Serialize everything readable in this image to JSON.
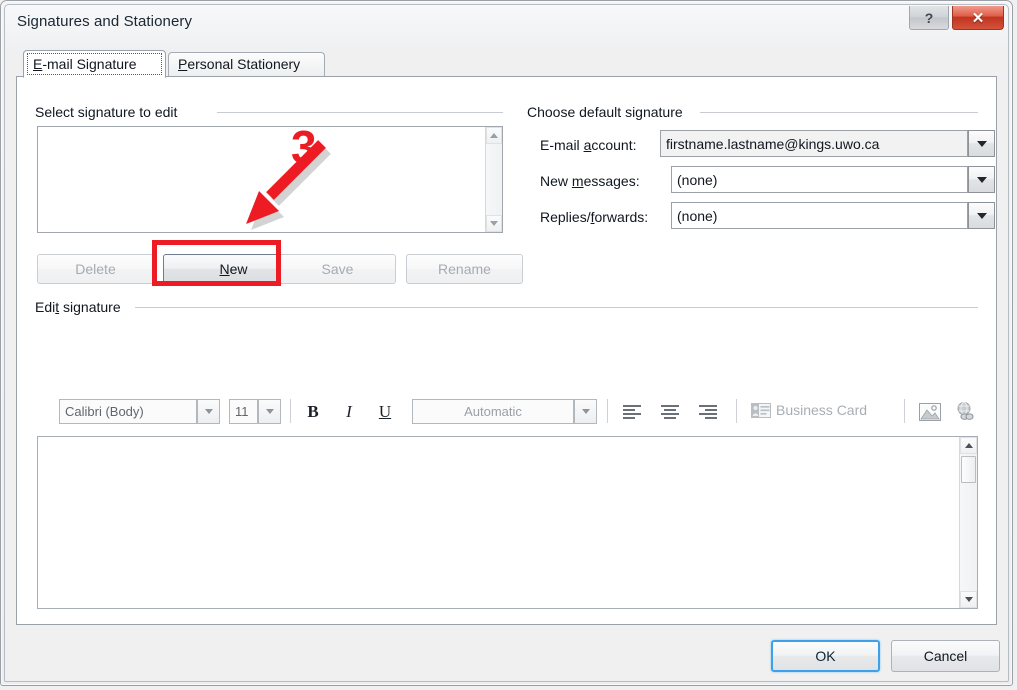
{
  "window": {
    "title": "Signatures and Stationery",
    "caption_buttons": [
      {
        "name": "help-button",
        "glyph": "?"
      },
      {
        "name": "close-button",
        "glyph": "✕"
      }
    ]
  },
  "tabs": [
    {
      "label_before": "E",
      "accel": "-",
      "label_full": "E-mail Signature",
      "selected": true
    },
    {
      "label_full": "Personal Stationery",
      "selected": false
    }
  ],
  "tab_labels": {
    "email_signature": "E-mail Signature",
    "personal_stationery": "Personal Stationery"
  },
  "groups": {
    "select_signature": "Select signature to edit",
    "choose_default": "Choose default signature",
    "edit_signature": "Edit signature"
  },
  "signature_list": {
    "items": [],
    "empty": ""
  },
  "list_buttons": [
    {
      "label": "Delete",
      "enabled": false
    },
    {
      "label": "New",
      "enabled": true,
      "highlighted": true
    },
    {
      "label": "Save",
      "enabled": false
    },
    {
      "label": "Rename",
      "enabled": false
    }
  ],
  "default_signature": {
    "email_account_label": "E-mail account:",
    "email_account_value": "firstname.lastname@kings.uwo.ca",
    "new_messages_label": "New messages:",
    "new_messages_value": "(none)",
    "replies_label": "Replies/forwards:",
    "replies_value": "(none)"
  },
  "toolbar": {
    "font_name": "Calibri (Body)",
    "font_size": "11",
    "bold": "B",
    "italic": "I",
    "underline": "U",
    "font_color": "Automatic",
    "highlight_color": "",
    "align_left": "align-left",
    "align_center": "align-center",
    "align_right": "align-right",
    "business_card": "Business Card",
    "picture": "picture",
    "hyperlink": "hyperlink"
  },
  "editor": {
    "content": ""
  },
  "footer": {
    "ok": "OK",
    "cancel": "Cancel"
  },
  "annotation": {
    "step_number": "3",
    "color": "#ed1c24",
    "target": "New"
  },
  "colors": {
    "annotation_red": "#ed1c24",
    "close_red": "#c0341f",
    "focus_blue": "#3da0e8",
    "window_bg": "#f0f0f0",
    "page_bg": "#ffffff"
  }
}
